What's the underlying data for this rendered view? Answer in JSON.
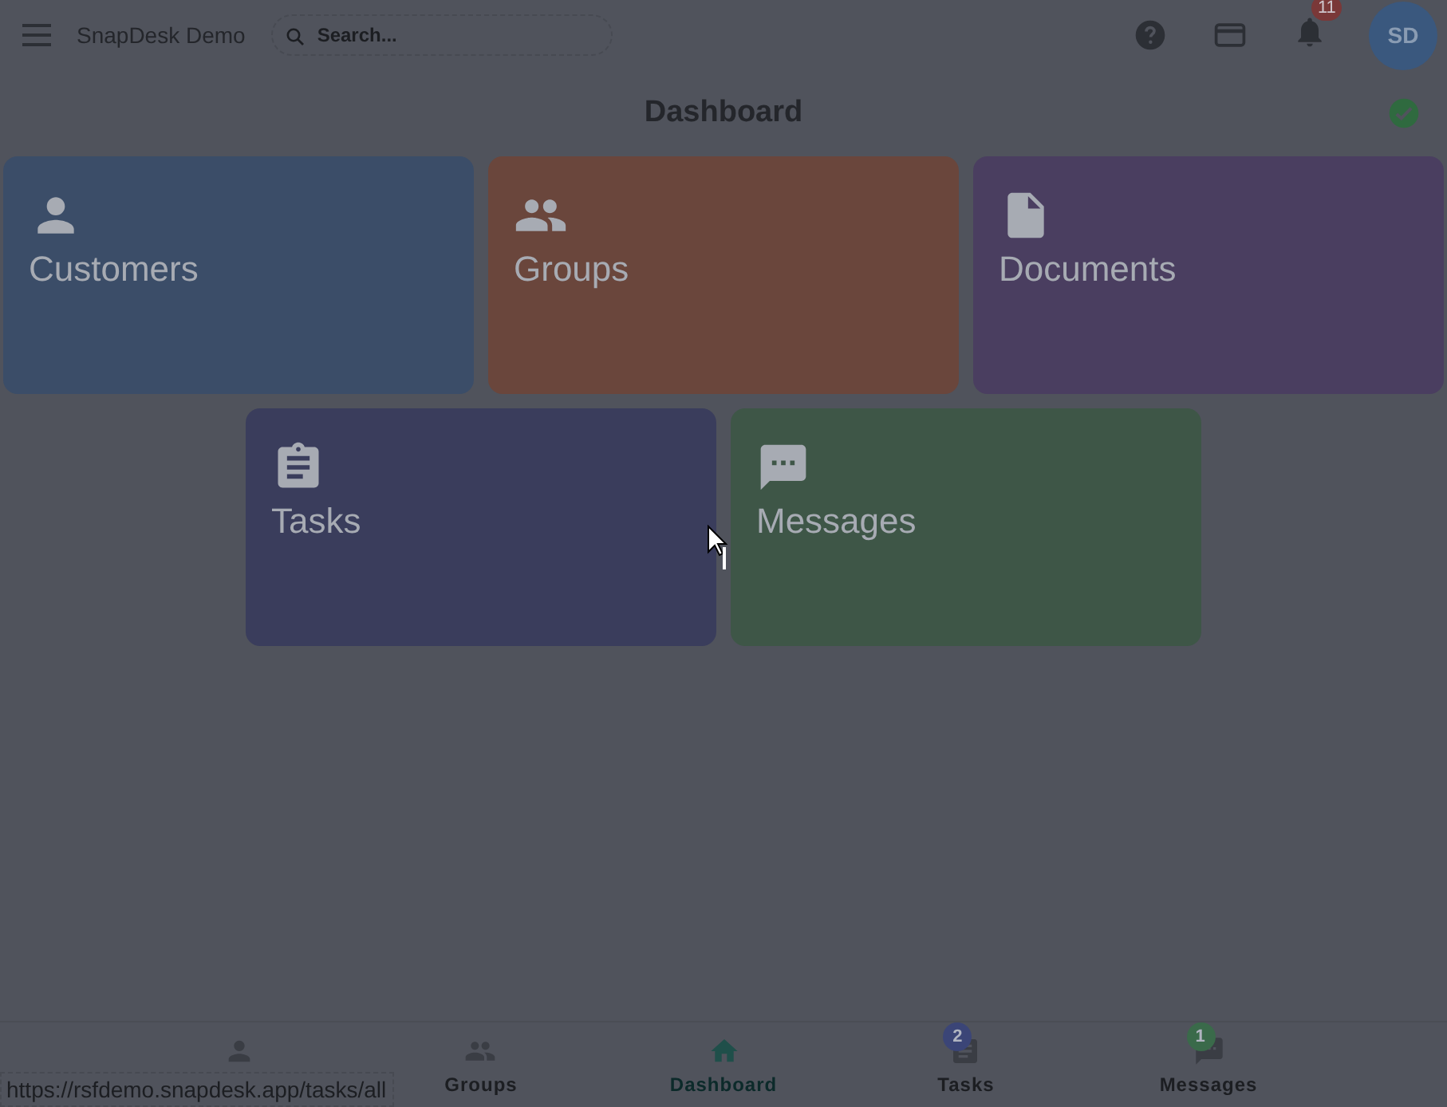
{
  "app_title": "SnapDesk Demo",
  "search": {
    "placeholder": "Search..."
  },
  "notifications": {
    "badge": "11"
  },
  "avatar": "SD",
  "page_title": "Dashboard",
  "cards": [
    {
      "label": "Customers",
      "kind": "person",
      "color": "#3b4d68"
    },
    {
      "label": "Groups",
      "kind": "people",
      "color": "#6a463c"
    },
    {
      "label": "Documents",
      "kind": "document",
      "color": "#4a3e60"
    },
    {
      "label": "Tasks",
      "kind": "clipboard",
      "color": "#3a3d5c"
    },
    {
      "label": "Messages",
      "kind": "chat",
      "color": "#3e5647"
    }
  ],
  "bottom_nav": [
    {
      "kind": "person",
      "selected": false
    },
    {
      "kind": "people",
      "label": "Groups",
      "selected": false
    },
    {
      "kind": "home",
      "label": "Dashboard",
      "selected": true
    },
    {
      "kind": "clipboard",
      "label": "Tasks",
      "selected": false,
      "badge": "2",
      "color": "#3b4577"
    },
    {
      "kind": "chat",
      "label": "Messages",
      "selected": false,
      "badge": "1",
      "color": "#3a6a4a"
    }
  ],
  "status_url": "https://rsfdemo.snapdesk.app/tasks/all"
}
